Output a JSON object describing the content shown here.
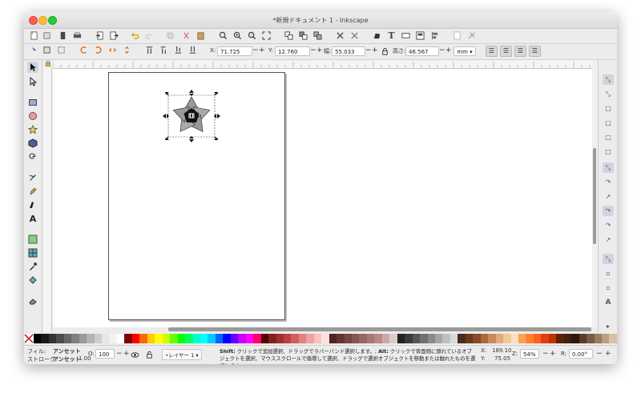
{
  "window": {
    "title": "*新規ドキュメント 1 - Inkscape"
  },
  "controls": {
    "x_label": "X:",
    "x_value": "71.725",
    "y_label": "Y:",
    "y_value": "12.760",
    "w_label": "幅:",
    "w_value": "55.033",
    "h_label": "高さ:",
    "h_value": "46.567",
    "unit": "mm",
    "minus": "−",
    "plus": "+"
  },
  "status": {
    "fill_label": "フィル:",
    "fill_value": "アンセット",
    "stroke_label": "ストローク:",
    "stroke_value": "アンセット",
    "stroke_width": "1.00",
    "opacity_label": "O:",
    "opacity_value": "100",
    "layer": "•レイヤー 1",
    "message_bold1": "Shift:",
    "message1": " クリックで追加選択、ドラッグでラバーバンド選択します。; ",
    "message_bold2": "Alt:",
    "message2": " クリックで背面側に隠れているオブジェクトを選択、マウススクロールで循環して選択、ドラッグで選択オブジェクトを移動または触れたものを選択します。",
    "cursor_x_label": "X:",
    "cursor_x": "189.10",
    "cursor_y_label": "Y:",
    "cursor_y": "75.05",
    "zoom_label": "Z:",
    "zoom": "54%",
    "rotation_label": "R:",
    "rotation": "0.00°"
  },
  "colors": {
    "accent": "#cfd5e0",
    "palette": [
      "#000000",
      "#1a1a1a",
      "#333333",
      "#4d4d4d",
      "#666666",
      "#808080",
      "#999999",
      "#b3b3b3",
      "#cccccc",
      "#e6e6e6",
      "#f2f2f2",
      "#ffffff",
      "#800000",
      "#ff0000",
      "#ff6600",
      "#ffcc00",
      "#ffff00",
      "#ccff00",
      "#66ff00",
      "#00ff00",
      "#00ff66",
      "#00ffcc",
      "#00ffff",
      "#00ccff",
      "#0066ff",
      "#0000ff",
      "#6600ff",
      "#cc00ff",
      "#ff00ff",
      "#ff0066",
      "#550000",
      "#802020",
      "#a03030",
      "#c04040",
      "#d06060",
      "#e08080",
      "#f0a0a0",
      "#ffc0c0",
      "#ffe0e0",
      "#552222",
      "#663333",
      "#774444",
      "#885555",
      "#996666",
      "#aa7777",
      "#bb8888",
      "#ccaaaa",
      "#ddcccc",
      "#222222",
      "#3a3a3a",
      "#555555",
      "#707070",
      "#8a8a8a",
      "#a5a5a5",
      "#c0c0c0",
      "#dadada",
      "#4a2a1a",
      "#6a3a1a",
      "#8a4a2a",
      "#aa6a3a",
      "#c88a5a",
      "#e0aa7a",
      "#f0c89a",
      "#f8e0c0",
      "#ffa050",
      "#ff8030",
      "#ff6020",
      "#e04010",
      "#c03000",
      "#602000",
      "#402010",
      "#301808",
      "#5a3a28",
      "#7a5a40",
      "#9a7a60",
      "#baa080",
      "#d8c0a0"
    ]
  }
}
